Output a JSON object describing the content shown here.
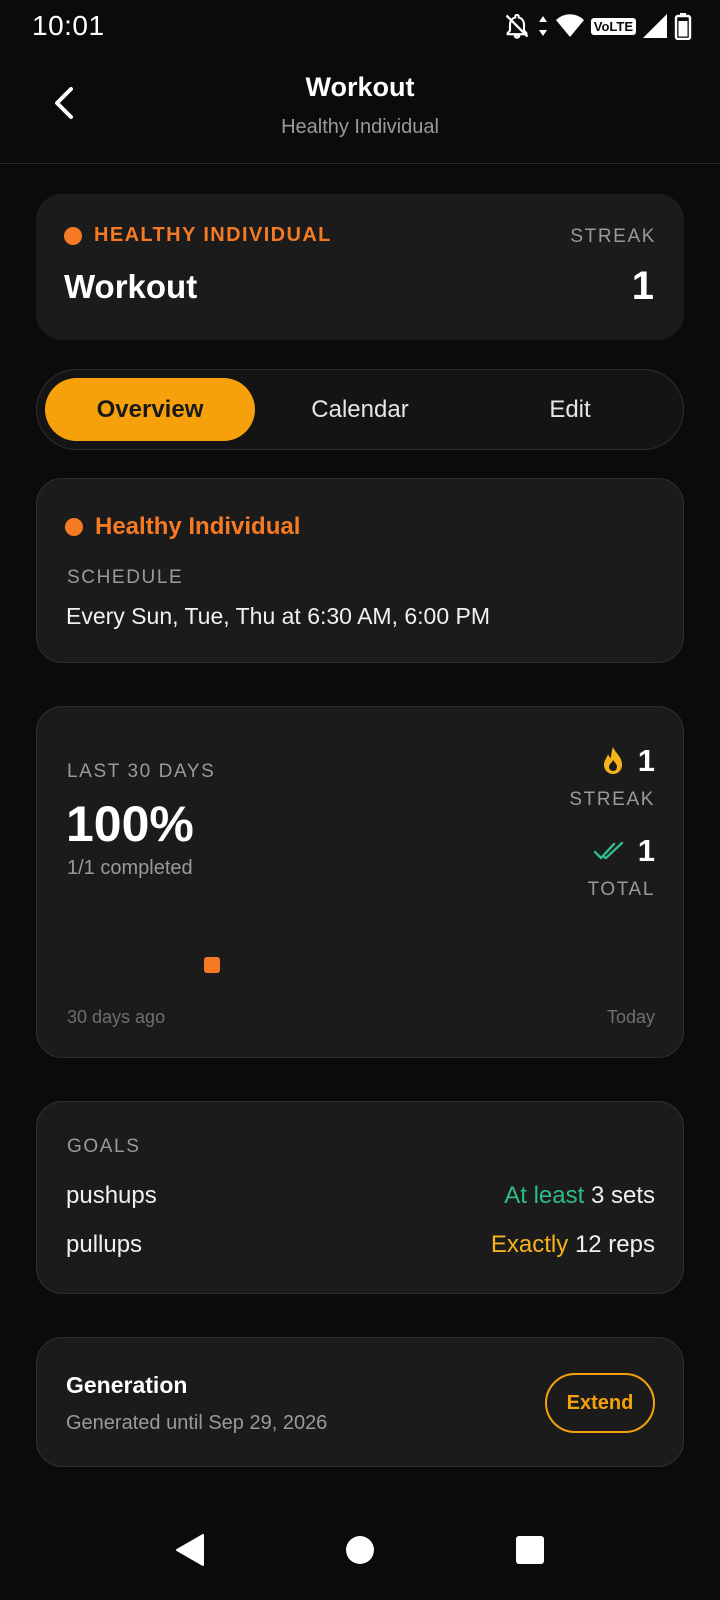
{
  "status_bar": {
    "time": "10:01",
    "network_label": "VoLTE",
    "icons": [
      "notifications-off-icon",
      "data-arrows-icon",
      "wifi-icon",
      "signal-icon",
      "battery-icon"
    ]
  },
  "header": {
    "title": "Workout",
    "subtitle": "Healthy Individual"
  },
  "habit_card": {
    "category": "HEALTHY INDIVIDUAL",
    "name": "Workout",
    "streak_label": "STREAK",
    "streak_value": "1",
    "accent_color": "#f57a23"
  },
  "tabs": [
    {
      "label": "Overview",
      "active": true
    },
    {
      "label": "Calendar",
      "active": false
    },
    {
      "label": "Edit",
      "active": false
    }
  ],
  "schedule": {
    "category": "Healthy Individual",
    "label": "SCHEDULE",
    "text": "Every  Sun, Tue, Thu at 6:30 AM, 6:00 PM"
  },
  "stats": {
    "period_label": "LAST 30 DAYS",
    "percent": "100%",
    "completed": "1/1 completed",
    "streak_value": "1",
    "streak_label": "STREAK",
    "total_value": "1",
    "total_label": "TOTAL",
    "range_start": "30 days ago",
    "range_end": "Today",
    "completed_days_ago": [
      23
    ]
  },
  "goals": {
    "label": "GOALS",
    "items": [
      {
        "name": "pushups",
        "comparator": "At least",
        "amount": "3 sets",
        "comparator_color": "#2ebd85"
      },
      {
        "name": "pullups",
        "comparator": "Exactly",
        "amount": "12 reps",
        "comparator_color": "#f6b31c"
      }
    ]
  },
  "generation": {
    "title": "Generation",
    "subtitle": "Generated until Sep 29, 2026",
    "extend_label": "Extend"
  },
  "colors": {
    "accent": "#f6a10c",
    "orange": "#f57a23",
    "background": "#0b0b0b",
    "card": "#1b1b1b"
  }
}
